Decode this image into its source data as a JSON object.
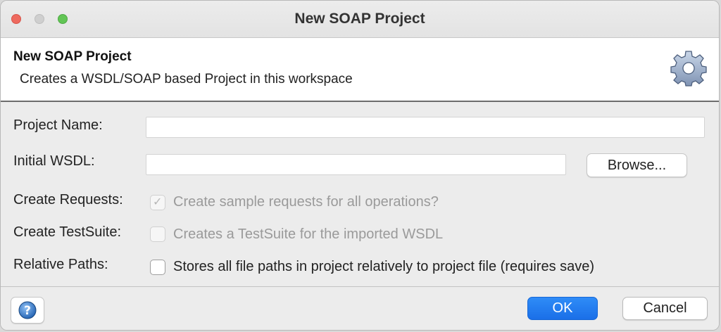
{
  "window": {
    "title": "New SOAP Project"
  },
  "header": {
    "title": "New SOAP Project",
    "description": "Creates a WSDL/SOAP based Project in this workspace",
    "icon": "gear-icon"
  },
  "form": {
    "project_name": {
      "label": "Project Name:",
      "value": "",
      "placeholder": ""
    },
    "initial_wsdl": {
      "label": "Initial WSDL:",
      "value": "",
      "placeholder": "",
      "browse_label": "Browse..."
    },
    "create_requests": {
      "label": "Create Requests:",
      "option_text": "Create sample requests for all operations?",
      "checked": true,
      "enabled": false
    },
    "create_testsuite": {
      "label": "Create TestSuite:",
      "option_text": "Creates a TestSuite for the imported WSDL",
      "checked": false,
      "enabled": false
    },
    "relative_paths": {
      "label": "Relative Paths:",
      "option_text": "Stores all file paths in project relatively to project file (requires save)",
      "checked": false,
      "enabled": true
    }
  },
  "footer": {
    "help_icon": "help-icon",
    "ok_label": "OK",
    "cancel_label": "Cancel"
  },
  "colors": {
    "accent": "#1a6fe8",
    "window_bg": "#ececec",
    "header_bg": "#ffffff",
    "disabled_text": "#9a9a9a"
  }
}
